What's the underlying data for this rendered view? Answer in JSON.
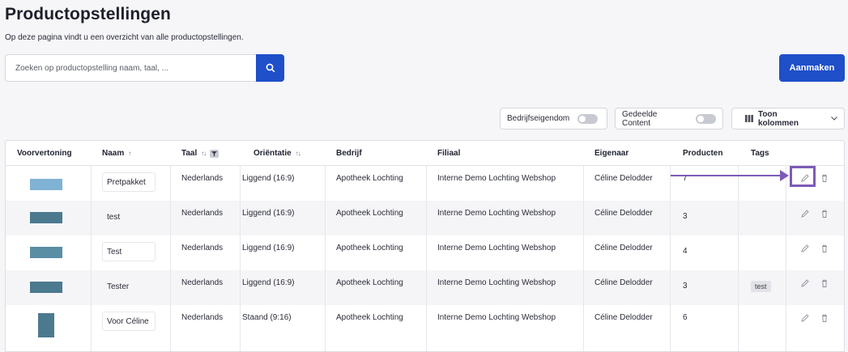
{
  "page": {
    "title": "Productopstellingen",
    "subtitle": "Op deze pagina vindt u een overzicht van alle productopstellingen."
  },
  "search": {
    "placeholder": "Zoeken op productopstelling naam, taal, ...",
    "button_icon": "search-icon"
  },
  "actions": {
    "create_label": "Aanmaken"
  },
  "filters": {
    "company_property_label": "Bedrijfseigendom",
    "shared_content_label": "Gedeelde Content",
    "columns_label": "Toon kolommen",
    "columns_icon": "columns-icon"
  },
  "table": {
    "headers": {
      "preview": "Voorvertoning",
      "name": "Naam",
      "language": "Taal",
      "orientation": "Oriëntatie",
      "company": "Bedrijf",
      "branch": "Filiaal",
      "owner": "Eigenaar",
      "products": "Producten",
      "tags": "Tags"
    },
    "rows": [
      {
        "name": "Pretpakket",
        "language": "Nederlands",
        "orientation": "Liggend (16:9)",
        "company": "Apotheek Lochting",
        "branch": "Interne Demo Lochting Webshop",
        "owner": "Céline Delodder",
        "products": "7",
        "tag": ""
      },
      {
        "name": "test",
        "language": "Nederlands",
        "orientation": "Liggend (16:9)",
        "company": "Apotheek Lochting",
        "branch": "Interne Demo Lochting Webshop",
        "owner": "Céline Delodder",
        "products": "3",
        "tag": ""
      },
      {
        "name": "Test",
        "language": "Nederlands",
        "orientation": "Liggend (16:9)",
        "company": "Apotheek Lochting",
        "branch": "Interne Demo Lochting Webshop",
        "owner": "Céline Delodder",
        "products": "4",
        "tag": ""
      },
      {
        "name": "Tester",
        "language": "Nederlands",
        "orientation": "Liggend (16:9)",
        "company": "Apotheek Lochting",
        "branch": "Interne Demo Lochting Webshop",
        "owner": "Céline Delodder",
        "products": "3",
        "tag": "test"
      },
      {
        "name": "Voor Céline",
        "language": "Nederlands",
        "orientation": "Staand (9:16)",
        "company": "Apotheek Lochting",
        "branch": "Interne Demo Lochting Webshop",
        "owner": "Céline Delodder",
        "products": "6",
        "tag": ""
      }
    ]
  },
  "colors": {
    "primary": "#1f4fc9",
    "annotation": "#7c5bb7",
    "thumbnail": "#4b7a8e"
  }
}
